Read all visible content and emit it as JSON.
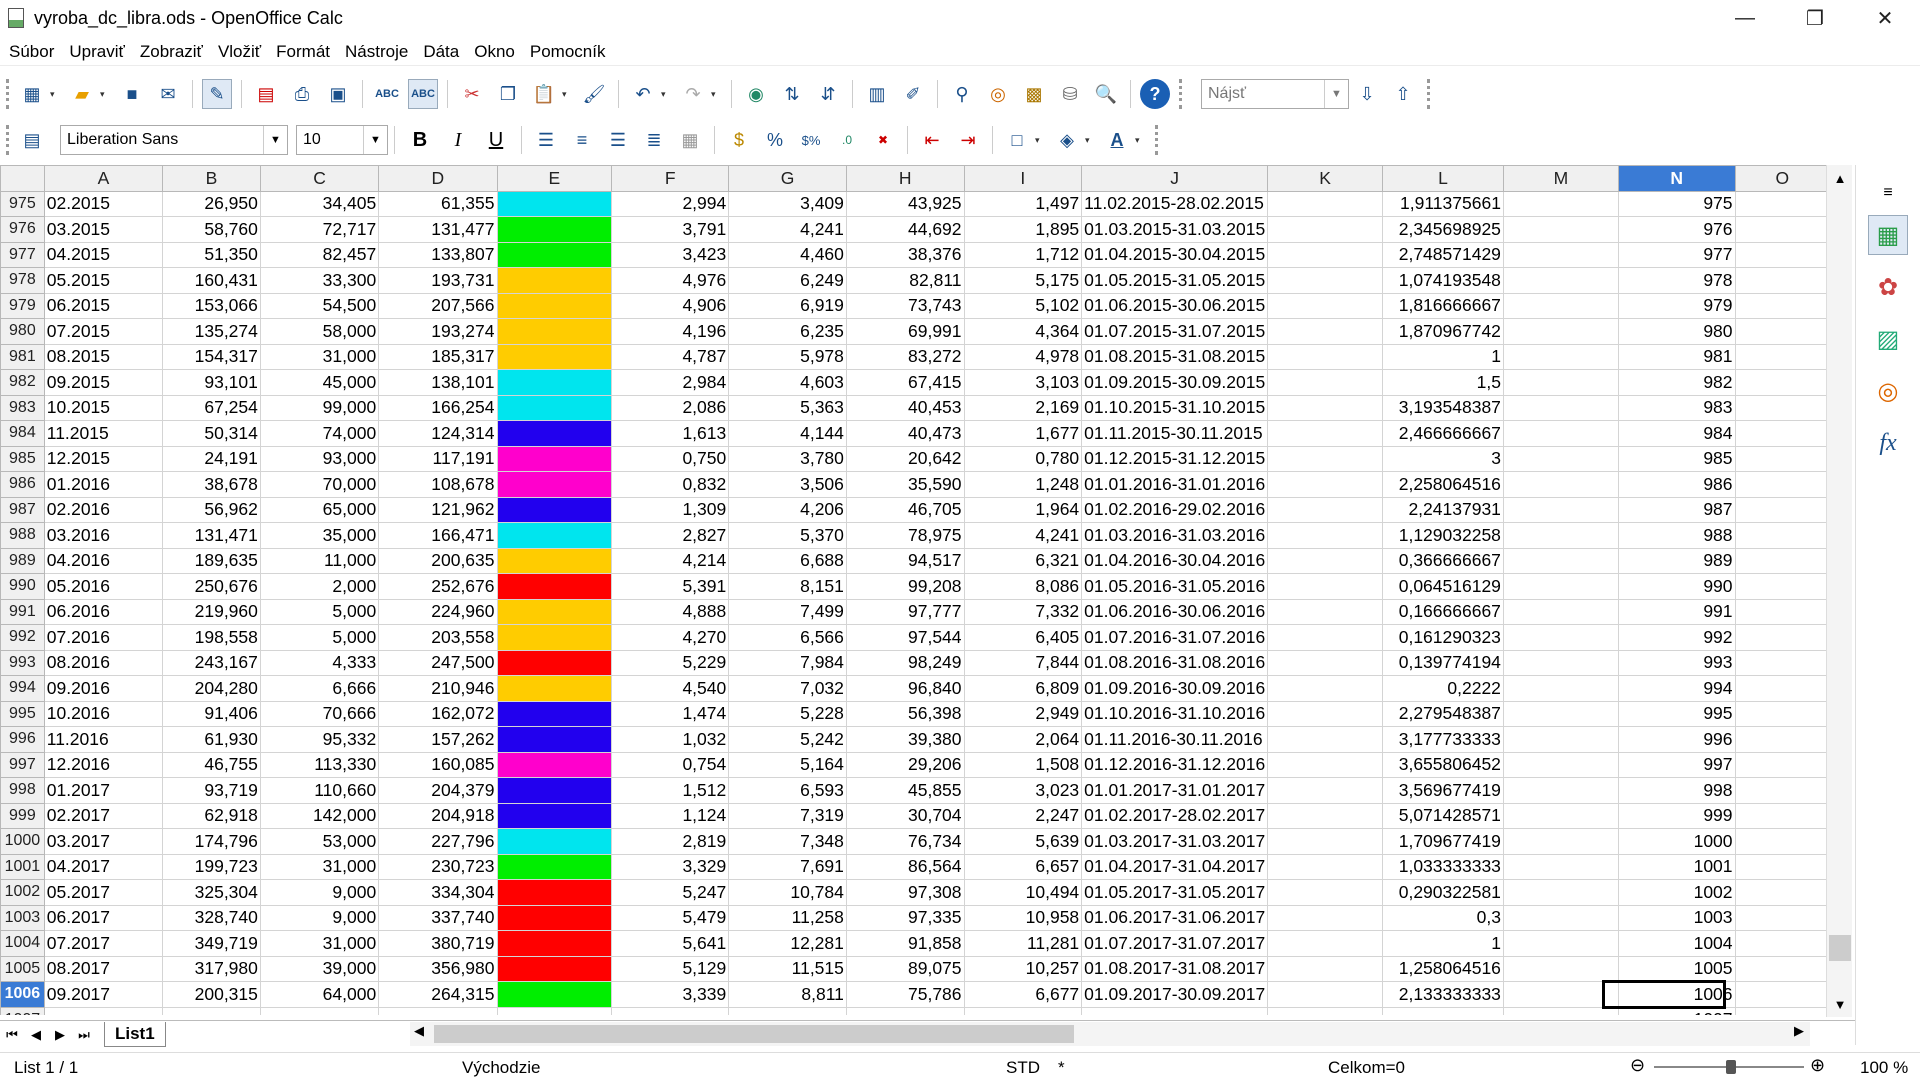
{
  "window": {
    "title": "vyroba_dc_libra.ods - OpenOffice Calc",
    "minimize": "—",
    "restore": "❐",
    "close": "✕"
  },
  "menu": [
    "Súbor",
    "Upraviť",
    "Zobraziť",
    "Vložiť",
    "Formát",
    "Nástroje",
    "Dáta",
    "Okno",
    "Pomocník"
  ],
  "toolbar": {
    "search_placeholder": "Nájsť",
    "font_name": "Liberation Sans",
    "font_size": "10"
  },
  "columns": [
    "A",
    "B",
    "C",
    "D",
    "E",
    "F",
    "G",
    "H",
    "I",
    "J",
    "K",
    "L",
    "M",
    "N",
    "O"
  ],
  "selected_column": "N",
  "selected_row": "1006",
  "colors": {
    "cyan": "#00e5ee",
    "green": "#00ee00",
    "yellow": "#ffcc00",
    "blue": "#2200ee",
    "magenta": "#ff00cc",
    "red": "#ff0000"
  },
  "rows": [
    {
      "n": "975",
      "a": "02.2015",
      "b": "26,950",
      "c": "34,405",
      "d": "61,355",
      "e": "cyan",
      "f": "2,994",
      "g": "3,409",
      "h": "43,925",
      "i": "1,497",
      "j": "11.02.2015-28.02.2015",
      "l": "1,911375661"
    },
    {
      "n": "976",
      "a": "03.2015",
      "b": "58,760",
      "c": "72,717",
      "d": "131,477",
      "e": "green",
      "f": "3,791",
      "g": "4,241",
      "h": "44,692",
      "i": "1,895",
      "j": "01.03.2015-31.03.2015",
      "l": "2,345698925"
    },
    {
      "n": "977",
      "a": "04.2015",
      "b": "51,350",
      "c": "82,457",
      "d": "133,807",
      "e": "green",
      "f": "3,423",
      "g": "4,460",
      "h": "38,376",
      "i": "1,712",
      "j": "01.04.2015-30.04.2015",
      "l": "2,748571429"
    },
    {
      "n": "978",
      "a": "05.2015",
      "b": "160,431",
      "c": "33,300",
      "d": "193,731",
      "e": "yellow",
      "f": "4,976",
      "g": "6,249",
      "h": "82,811",
      "i": "5,175",
      "j": "01.05.2015-31.05.2015",
      "l": "1,074193548"
    },
    {
      "n": "979",
      "a": "06.2015",
      "b": "153,066",
      "c": "54,500",
      "d": "207,566",
      "e": "yellow",
      "f": "4,906",
      "g": "6,919",
      "h": "73,743",
      "i": "5,102",
      "j": "01.06.2015-30.06.2015",
      "l": "1,816666667"
    },
    {
      "n": "980",
      "a": "07.2015",
      "b": "135,274",
      "c": "58,000",
      "d": "193,274",
      "e": "yellow",
      "f": "4,196",
      "g": "6,235",
      "h": "69,991",
      "i": "4,364",
      "j": "01.07.2015-31.07.2015",
      "l": "1,870967742"
    },
    {
      "n": "981",
      "a": "08.2015",
      "b": "154,317",
      "c": "31,000",
      "d": "185,317",
      "e": "yellow",
      "f": "4,787",
      "g": "5,978",
      "h": "83,272",
      "i": "4,978",
      "j": "01.08.2015-31.08.2015",
      "l": "1"
    },
    {
      "n": "982",
      "a": "09.2015",
      "b": "93,101",
      "c": "45,000",
      "d": "138,101",
      "e": "cyan",
      "f": "2,984",
      "g": "4,603",
      "h": "67,415",
      "i": "3,103",
      "j": "01.09.2015-30.09.2015",
      "l": "1,5"
    },
    {
      "n": "983",
      "a": "10.2015",
      "b": "67,254",
      "c": "99,000",
      "d": "166,254",
      "e": "cyan",
      "f": "2,086",
      "g": "5,363",
      "h": "40,453",
      "i": "2,169",
      "j": "01.10.2015-31.10.2015",
      "l": "3,193548387"
    },
    {
      "n": "984",
      "a": "11.2015",
      "b": "50,314",
      "c": "74,000",
      "d": "124,314",
      "e": "blue",
      "f": "1,613",
      "g": "4,144",
      "h": "40,473",
      "i": "1,677",
      "j": "01.11.2015-30.11.2015",
      "l": "2,466666667"
    },
    {
      "n": "985",
      "a": "12.2015",
      "b": "24,191",
      "c": "93,000",
      "d": "117,191",
      "e": "magenta",
      "f": "0,750",
      "g": "3,780",
      "h": "20,642",
      "i": "0,780",
      "j": "01.12.2015-31.12.2015",
      "l": "3"
    },
    {
      "n": "986",
      "a": "01.2016",
      "b": "38,678",
      "c": "70,000",
      "d": "108,678",
      "e": "magenta",
      "f": "0,832",
      "g": "3,506",
      "h": "35,590",
      "i": "1,248",
      "j": "01.01.2016-31.01.2016",
      "l": "2,258064516"
    },
    {
      "n": "987",
      "a": "02.2016",
      "b": "56,962",
      "c": "65,000",
      "d": "121,962",
      "e": "blue",
      "f": "1,309",
      "g": "4,206",
      "h": "46,705",
      "i": "1,964",
      "j": "01.02.2016-29.02.2016",
      "l": "2,24137931"
    },
    {
      "n": "988",
      "a": "03.2016",
      "b": "131,471",
      "c": "35,000",
      "d": "166,471",
      "e": "cyan",
      "f": "2,827",
      "g": "5,370",
      "h": "78,975",
      "i": "4,241",
      "j": "01.03.2016-31.03.2016",
      "l": "1,129032258"
    },
    {
      "n": "989",
      "a": "04.2016",
      "b": "189,635",
      "c": "11,000",
      "d": "200,635",
      "e": "yellow",
      "f": "4,214",
      "g": "6,688",
      "h": "94,517",
      "i": "6,321",
      "j": "01.04.2016-30.04.2016",
      "l": "0,366666667"
    },
    {
      "n": "990",
      "a": "05.2016",
      "b": "250,676",
      "c": "2,000",
      "d": "252,676",
      "e": "red",
      "f": "5,391",
      "g": "8,151",
      "h": "99,208",
      "i": "8,086",
      "j": "01.05.2016-31.05.2016",
      "l": "0,064516129"
    },
    {
      "n": "991",
      "a": "06.2016",
      "b": "219,960",
      "c": "5,000",
      "d": "224,960",
      "e": "yellow",
      "f": "4,888",
      "g": "7,499",
      "h": "97,777",
      "i": "7,332",
      "j": "01.06.2016-30.06.2016",
      "l": "0,166666667"
    },
    {
      "n": "992",
      "a": "07.2016",
      "b": "198,558",
      "c": "5,000",
      "d": "203,558",
      "e": "yellow",
      "f": "4,270",
      "g": "6,566",
      "h": "97,544",
      "i": "6,405",
      "j": "01.07.2016-31.07.2016",
      "l": "0,161290323"
    },
    {
      "n": "993",
      "a": "08.2016",
      "b": "243,167",
      "c": "4,333",
      "d": "247,500",
      "e": "red",
      "f": "5,229",
      "g": "7,984",
      "h": "98,249",
      "i": "7,844",
      "j": "01.08.2016-31.08.2016",
      "l": "0,139774194"
    },
    {
      "n": "994",
      "a": "09.2016",
      "b": "204,280",
      "c": "6,666",
      "d": "210,946",
      "e": "yellow",
      "f": "4,540",
      "g": "7,032",
      "h": "96,840",
      "i": "6,809",
      "j": "01.09.2016-30.09.2016",
      "l": "0,2222"
    },
    {
      "n": "995",
      "a": "10.2016",
      "b": "91,406",
      "c": "70,666",
      "d": "162,072",
      "e": "blue",
      "f": "1,474",
      "g": "5,228",
      "h": "56,398",
      "i": "2,949",
      "j": "01.10.2016-31.10.2016",
      "l": "2,279548387"
    },
    {
      "n": "996",
      "a": "11.2016",
      "b": "61,930",
      "c": "95,332",
      "d": "157,262",
      "e": "blue",
      "f": "1,032",
      "g": "5,242",
      "h": "39,380",
      "i": "2,064",
      "j": "01.11.2016-30.11.2016",
      "l": "3,177733333"
    },
    {
      "n": "997",
      "a": "12.2016",
      "b": "46,755",
      "c": "113,330",
      "d": "160,085",
      "e": "magenta",
      "f": "0,754",
      "g": "5,164",
      "h": "29,206",
      "i": "1,508",
      "j": "01.12.2016-31.12.2016",
      "l": "3,655806452"
    },
    {
      "n": "998",
      "a": "01.2017",
      "b": "93,719",
      "c": "110,660",
      "d": "204,379",
      "e": "blue",
      "f": "1,512",
      "g": "6,593",
      "h": "45,855",
      "i": "3,023",
      "j": "01.01.2017-31.01.2017",
      "l": "3,569677419"
    },
    {
      "n": "999",
      "a": "02.2017",
      "b": "62,918",
      "c": "142,000",
      "d": "204,918",
      "e": "blue",
      "f": "1,124",
      "g": "7,319",
      "h": "30,704",
      "i": "2,247",
      "j": "01.02.2017-28.02.2017",
      "l": "5,071428571"
    },
    {
      "n": "1000",
      "a": "03.2017",
      "b": "174,796",
      "c": "53,000",
      "d": "227,796",
      "e": "cyan",
      "f": "2,819",
      "g": "7,348",
      "h": "76,734",
      "i": "5,639",
      "j": "01.03.2017-31.03.2017",
      "l": "1,709677419"
    },
    {
      "n": "1001",
      "a": "04.2017",
      "b": "199,723",
      "c": "31,000",
      "d": "230,723",
      "e": "green",
      "f": "3,329",
      "g": "7,691",
      "h": "86,564",
      "i": "6,657",
      "j": "01.04.2017-31.04.2017",
      "l": "1,033333333"
    },
    {
      "n": "1002",
      "a": "05.2017",
      "b": "325,304",
      "c": "9,000",
      "d": "334,304",
      "e": "red",
      "f": "5,247",
      "g": "10,784",
      "h": "97,308",
      "i": "10,494",
      "j": "01.05.2017-31.05.2017",
      "l": "0,290322581"
    },
    {
      "n": "1003",
      "a": "06.2017",
      "b": "328,740",
      "c": "9,000",
      "d": "337,740",
      "e": "red",
      "f": "5,479",
      "g": "11,258",
      "h": "97,335",
      "i": "10,958",
      "j": "01.06.2017-31.06.2017",
      "l": "0,3"
    },
    {
      "n": "1004",
      "a": "07.2017",
      "b": "349,719",
      "c": "31,000",
      "d": "380,719",
      "e": "red",
      "f": "5,641",
      "g": "12,281",
      "h": "91,858",
      "i": "11,281",
      "j": "01.07.2017-31.07.2017",
      "l": "1"
    },
    {
      "n": "1005",
      "a": "08.2017",
      "b": "317,980",
      "c": "39,000",
      "d": "356,980",
      "e": "red",
      "f": "5,129",
      "g": "11,515",
      "h": "89,075",
      "i": "10,257",
      "j": "01.08.2017-31.08.2017",
      "l": "1,258064516"
    },
    {
      "n": "1006",
      "a": "09.2017",
      "b": "200,315",
      "c": "64,000",
      "d": "264,315",
      "e": "green",
      "f": "3,339",
      "g": "8,811",
      "h": "75,786",
      "i": "6,677",
      "j": "01.09.2017-30.09.2017",
      "l": "2,133333333"
    },
    {
      "n": "1007",
      "a": "",
      "b": "",
      "c": "",
      "d": "",
      "e": "",
      "f": "",
      "g": "",
      "h": "",
      "i": "",
      "j": "",
      "l": ""
    }
  ],
  "tabs": {
    "active": "List1"
  },
  "status": {
    "sheet": "List 1 / 1",
    "style": "Východzie",
    "mode": "STD",
    "modified": "*",
    "sum": "Celkom=0",
    "zoom": "100 %",
    "zoom_level": 100
  }
}
